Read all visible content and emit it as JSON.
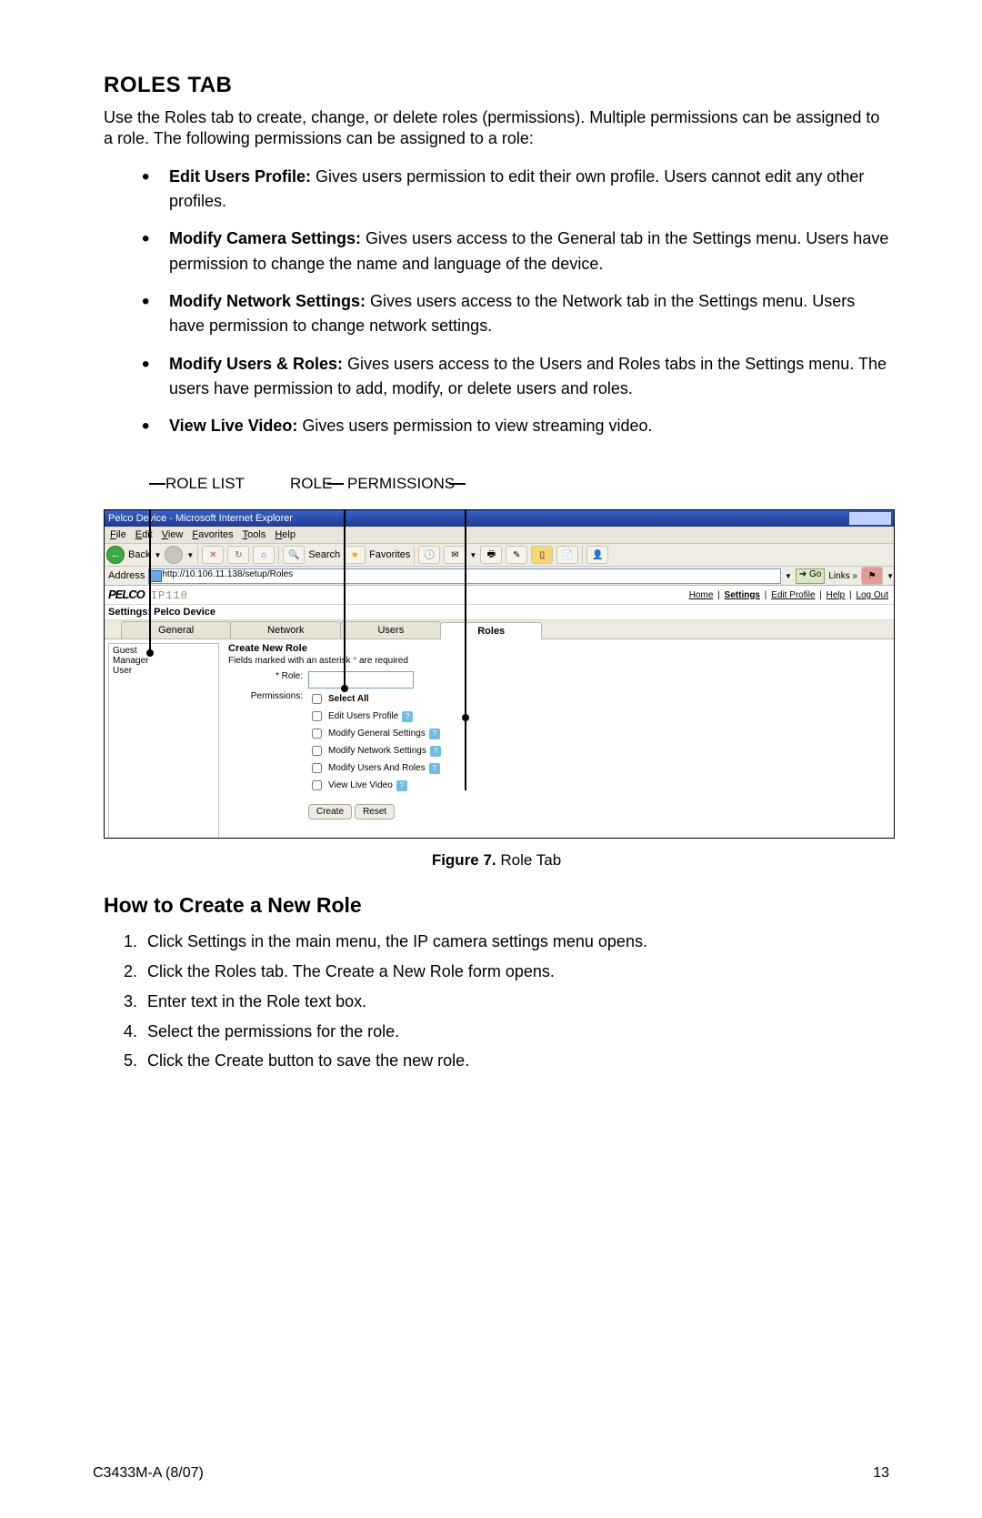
{
  "heading": "ROLES TAB",
  "intro": "Use the Roles tab to create, change, or delete roles (permissions). Multiple permissions can be assigned to a role. The following permissions can be assigned to a role:",
  "perms": [
    {
      "b": "Edit Users Profile:",
      "t": " Gives users permission to edit their own profile. Users cannot edit any other profiles."
    },
    {
      "b": "Modify Camera Settings:",
      "t": " Gives users access to the General tab in the Settings menu. Users have permission to change the name and language of the device."
    },
    {
      "b": "Modify Network Settings:",
      "t": " Gives users access to the Network tab in the Settings menu. Users have permission to change network settings."
    },
    {
      "b": "Modify Users & Roles:",
      "t": " Gives users access to the Users and Roles tabs in the Settings menu. The users have permission to add, modify, or delete users and roles."
    },
    {
      "b": "View Live Video:",
      "t": " Gives users permission to view streaming video."
    }
  ],
  "annot": {
    "role_list": "ROLE LIST",
    "role": "ROLE",
    "permissions": "PERMISSIONS"
  },
  "browser": {
    "title": "Pelco Device - Microsoft Internet Explorer",
    "menus": [
      "File",
      "Edit",
      "View",
      "Favorites",
      "Tools",
      "Help"
    ],
    "back": "Back",
    "search": "Search",
    "favorites": "Favorites",
    "address_label": "Address",
    "address": "http://10.106.11.138/setup/Roles",
    "go": "Go",
    "links": "Links"
  },
  "pelco": {
    "logo": "PELCO",
    "model": "IP110",
    "nav": {
      "home": "Home",
      "settings": "Settings",
      "edit_profile": "Edit Profile",
      "help": "Help",
      "logout": "Log Out"
    },
    "settings_title": "Settings: Pelco Device",
    "tabs": {
      "general": "General",
      "network": "Network",
      "users": "Users",
      "roles": "Roles"
    },
    "role_list": [
      "Guest",
      "Manager",
      "User"
    ],
    "form": {
      "heading": "Create New Role",
      "note_pre": "Fields marked with an asterisk ",
      "note_post": " are required",
      "role_label": "* Role:",
      "perm_label": "Permissions:",
      "perms": [
        "Select All",
        "Edit Users Profile",
        "Modify General Settings",
        "Modify Network Settings",
        "Modify Users And Roles",
        "View Live Video"
      ],
      "create": "Create",
      "reset": "Reset"
    }
  },
  "caption_b": "Figure 7.",
  "caption_t": "  Role Tab",
  "howto_heading": "How to Create a New Role",
  "steps": [
    "Click Settings in the main menu, the IP camera settings menu opens.",
    "Click the Roles tab. The Create a New Role form opens.",
    "Enter text in the Role text box.",
    "Select the permissions for the role.",
    "Click the Create button to save the new role."
  ],
  "footer_left": "C3433M-A (8/07)",
  "footer_right": "13"
}
